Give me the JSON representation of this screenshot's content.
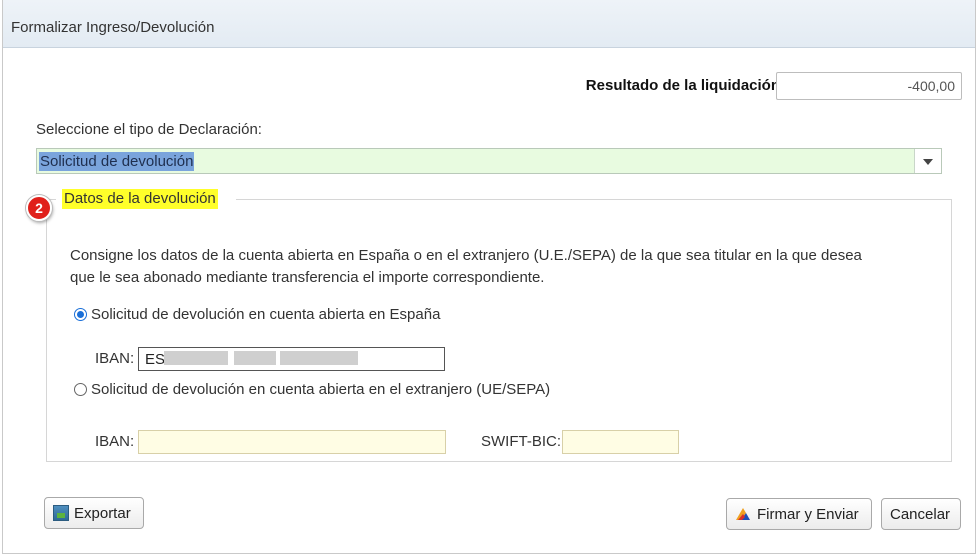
{
  "window": {
    "title": "Formalizar Ingreso/Devolución"
  },
  "result": {
    "label": "Resultado de la liquidación",
    "value": "-400,00"
  },
  "declaration": {
    "label": "Seleccione el tipo de Declaración:",
    "selected": "Solicitud de devolución"
  },
  "refund_section": {
    "badge": "2",
    "legend": "Datos de la devolución",
    "description_line1": "Consigne los datos de la cuenta abierta en España o en el extranjero (U.E./SEPA) de la que sea titular en la que desea",
    "description_line2": "que le sea abonado mediante transferencia el importe correspondiente.",
    "option_spain": "Solicitud de devolución en cuenta abierta en España",
    "option_abroad": "Solicitud de devolución en cuenta abierta en el extranjero (UE/SEPA)",
    "iban_label": "IBAN:",
    "iban_spain_value": "ES",
    "swift_label": "SWIFT-BIC:"
  },
  "footer": {
    "export_label": "Exportar",
    "sign_label": "Firmar y Enviar",
    "cancel_label": "Cancelar"
  },
  "colors": {
    "accent": "#1a6fd8",
    "highlight": "#ffff2a",
    "select_bg": "#e8fbe0",
    "badge": "#e0201b",
    "pale_input": "#fffde4"
  },
  "icons": {
    "export": "export-icon",
    "sign": "sign-icon",
    "dropdown": "chevron-down-icon",
    "badge": "step-number-badge"
  }
}
